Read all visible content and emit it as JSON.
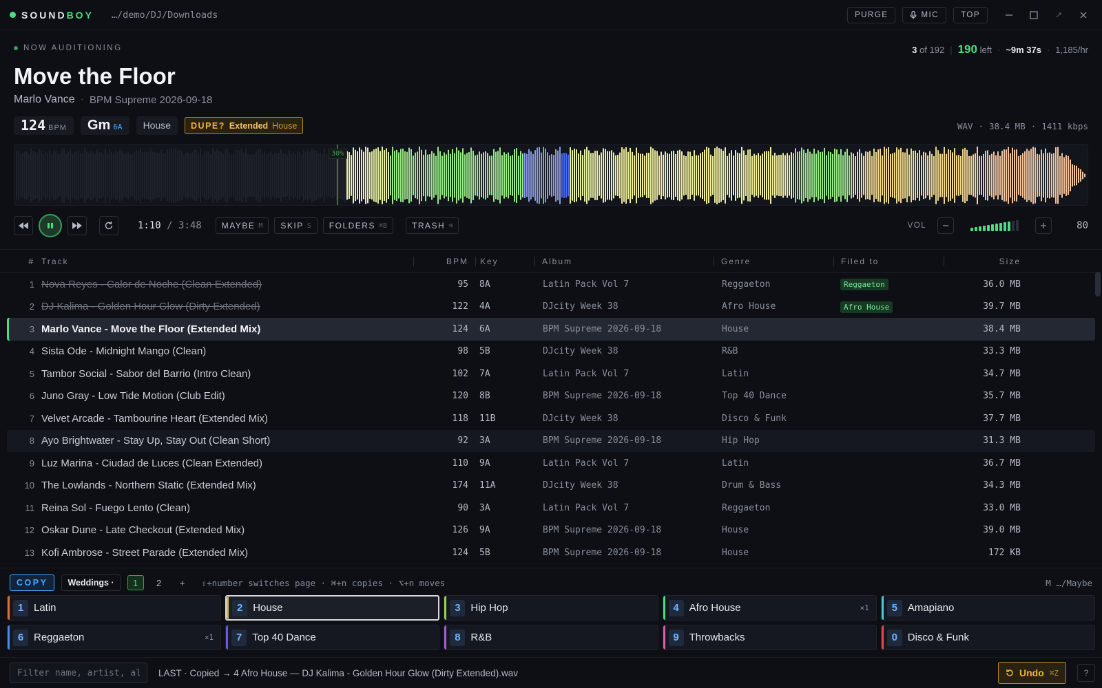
{
  "app": {
    "brand_a": "SOUND",
    "brand_b": "BOY",
    "path": "…/demo/DJ/Downloads"
  },
  "titlebar": {
    "purge": "PURGE",
    "mic": "MIC",
    "top": "TOP"
  },
  "now": {
    "label": "NOW AUDITIONING",
    "title": "Move the Floor",
    "artist": "Marlo Vance",
    "album": "BPM Supreme 2026-09-18",
    "bpm": "124",
    "bpm_unit": "BPM",
    "key": "Gm",
    "camelot": "6A",
    "genre": "House",
    "dupe_label": "DUPE?",
    "dupe_version": "Extended",
    "dupe_genre": "House",
    "format": "WAV",
    "size": "38.4 MB",
    "bitrate": "1411 kbps"
  },
  "stats": {
    "position": "3",
    "of": "of 192",
    "left": "190",
    "left_label": "left",
    "eta": "~9m 37s",
    "rate": "1,185/hr"
  },
  "waveform": {
    "marker": "30%",
    "played_fraction": 0.3
  },
  "transport": {
    "elapsed": "1:10",
    "total": "/ 3:48",
    "maybe": "MAYBE",
    "maybe_key": "M",
    "skip": "SKIP",
    "skip_key": "S",
    "folders": "FOLDERS",
    "folders_key": "⌘B",
    "trash": "TRASH",
    "trash_key": "⌫",
    "vol_label": "VOL",
    "volume": "80",
    "volume_level": 0.8
  },
  "table": {
    "headers": {
      "num": "#",
      "track": "Track",
      "bpm": "BPM",
      "key": "Key",
      "album": "Album",
      "genre": "Genre",
      "filed": "Filed to",
      "size": "Size"
    },
    "rows": [
      {
        "num": "1",
        "track": "Nova Reyes - Calor de Noche (Clean Extended)",
        "bpm": "95",
        "key": "8A",
        "album": "Latin Pack Vol 7",
        "genre": "Reggaeton",
        "filed": "Reggaeton",
        "size": "36.0 MB",
        "state": "done"
      },
      {
        "num": "2",
        "track": "DJ Kalima - Golden Hour Glow (Dirty Extended)",
        "bpm": "122",
        "key": "4A",
        "album": "DJcity Week 38",
        "genre": "Afro House",
        "filed": "Afro House",
        "size": "39.7 MB",
        "state": "done"
      },
      {
        "num": "3",
        "track": "Marlo Vance - Move the Floor (Extended Mix)",
        "bpm": "124",
        "key": "6A",
        "album": "BPM Supreme 2026-09-18",
        "genre": "House",
        "filed": "",
        "size": "38.4 MB",
        "state": "current"
      },
      {
        "num": "4",
        "track": "Sista Ode - Midnight Mango (Clean)",
        "bpm": "98",
        "key": "5B",
        "album": "DJcity Week 38",
        "genre": "R&B",
        "filed": "",
        "size": "33.3 MB",
        "state": ""
      },
      {
        "num": "5",
        "track": "Tambor Social - Sabor del Barrio (Intro Clean)",
        "bpm": "102",
        "key": "7A",
        "album": "Latin Pack Vol 7",
        "genre": "Latin",
        "filed": "",
        "size": "34.7 MB",
        "state": ""
      },
      {
        "num": "6",
        "track": "Juno Gray - Low Tide Motion (Club Edit)",
        "bpm": "120",
        "key": "8B",
        "album": "BPM Supreme 2026-09-18",
        "genre": "Top 40 Dance",
        "filed": "",
        "size": "35.7 MB",
        "state": ""
      },
      {
        "num": "7",
        "track": "Velvet Arcade - Tambourine Heart (Extended Mix)",
        "bpm": "118",
        "key": "11B",
        "album": "DJcity Week 38",
        "genre": "Disco & Funk",
        "filed": "",
        "size": "37.7 MB",
        "state": ""
      },
      {
        "num": "8",
        "track": "Ayo Brightwater - Stay Up, Stay Out (Clean Short)",
        "bpm": "92",
        "key": "3A",
        "album": "BPM Supreme 2026-09-18",
        "genre": "Hip Hop",
        "filed": "",
        "size": "31.3 MB",
        "state": "hover"
      },
      {
        "num": "9",
        "track": "Luz Marina - Ciudad de Luces (Clean Extended)",
        "bpm": "110",
        "key": "9A",
        "album": "Latin Pack Vol 7",
        "genre": "Latin",
        "filed": "",
        "size": "36.7 MB",
        "state": ""
      },
      {
        "num": "10",
        "track": "The Lowlands - Northern Static (Extended Mix)",
        "bpm": "174",
        "key": "11A",
        "album": "DJcity Week 38",
        "genre": "Drum & Bass",
        "filed": "",
        "size": "34.3 MB",
        "state": ""
      },
      {
        "num": "11",
        "track": "Reina Sol - Fuego Lento (Clean)",
        "bpm": "90",
        "key": "3A",
        "album": "Latin Pack Vol 7",
        "genre": "Reggaeton",
        "filed": "",
        "size": "33.0 MB",
        "state": ""
      },
      {
        "num": "12",
        "track": "Oskar Dune - Late Checkout (Extended Mix)",
        "bpm": "126",
        "key": "9A",
        "album": "BPM Supreme 2026-09-18",
        "genre": "House",
        "filed": "",
        "size": "39.0 MB",
        "state": ""
      },
      {
        "num": "13",
        "track": "Kofi Ambrose - Street Parade (Extended Mix)",
        "bpm": "124",
        "key": "5B",
        "album": "BPM Supreme 2026-09-18",
        "genre": "House",
        "filed": "",
        "size": "172 KB",
        "state": ""
      }
    ]
  },
  "folders": {
    "mode": "COPY",
    "set": "Weddings ·",
    "pages": [
      "1",
      "2",
      "+"
    ],
    "hint": "⇧+number switches page · ⌘+n copies · ⌥+n moves",
    "maybe_path": "M …/Maybe",
    "items": [
      {
        "n": "1",
        "label": "Latin",
        "count": "",
        "color": "#e0703a",
        "selected": false
      },
      {
        "n": "2",
        "label": "House",
        "count": "",
        "color": "#d8b84a",
        "selected": true
      },
      {
        "n": "3",
        "label": "Hip Hop",
        "count": "",
        "color": "#9bd24a",
        "selected": false
      },
      {
        "n": "4",
        "label": "Afro House",
        "count": "×1",
        "color": "#4ade80",
        "selected": false
      },
      {
        "n": "5",
        "label": "Amapiano",
        "count": "",
        "color": "#4ac6d8",
        "selected": false
      },
      {
        "n": "6",
        "label": "Reggaeton",
        "count": "×1",
        "color": "#4a8ae0",
        "selected": false
      },
      {
        "n": "7",
        "label": "Top 40 Dance",
        "count": "",
        "color": "#6a5ae0",
        "selected": false
      },
      {
        "n": "8",
        "label": "R&B",
        "count": "",
        "color": "#a85ae0",
        "selected": false
      },
      {
        "n": "9",
        "label": "Throwbacks",
        "count": "",
        "color": "#e05aa8",
        "selected": false
      },
      {
        "n": "0",
        "label": "Disco & Funk",
        "count": "",
        "color": "#e04a4a",
        "selected": false
      }
    ]
  },
  "bottom": {
    "filter_placeholder": "Filter name, artist, album",
    "last": "LAST · Copied → 4 Afro House — DJ Kalima - Golden Hour Glow (Dirty Extended).wav",
    "undo": "Undo",
    "undo_key": "⌘Z",
    "help": "?"
  },
  "colors": {
    "accent": "#4ade80",
    "blue": "#4aa8ff",
    "amber": "#f0b43a",
    "bg": "#0d0f14"
  }
}
